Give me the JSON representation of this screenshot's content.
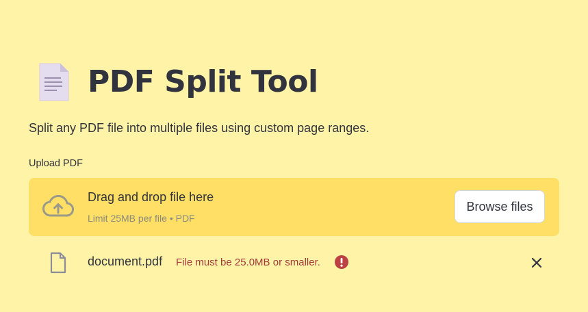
{
  "header": {
    "title": "PDF Split Tool",
    "emoji": "page-facing-up-icon",
    "subtitle": "Split any PDF file into multiple files using custom page ranges."
  },
  "uploader": {
    "label": "Upload PDF",
    "dropzone_text": "Drag and drop file here",
    "limit_text": "Limit 25MB per file • PDF",
    "browse_label": "Browse files",
    "icon": "cloud-upload-icon"
  },
  "uploaded_file": {
    "name": "document.pdf",
    "error": "File must be 25.0MB or smaller.",
    "icon": "file-icon",
    "error_icon": "error-icon",
    "remove_icon": "close-icon"
  },
  "colors": {
    "background": "#fff3a8",
    "dropzone": "#ffdf66",
    "text": "#31333f",
    "error": "#a23a3a",
    "error_badge": "#bd4043"
  }
}
